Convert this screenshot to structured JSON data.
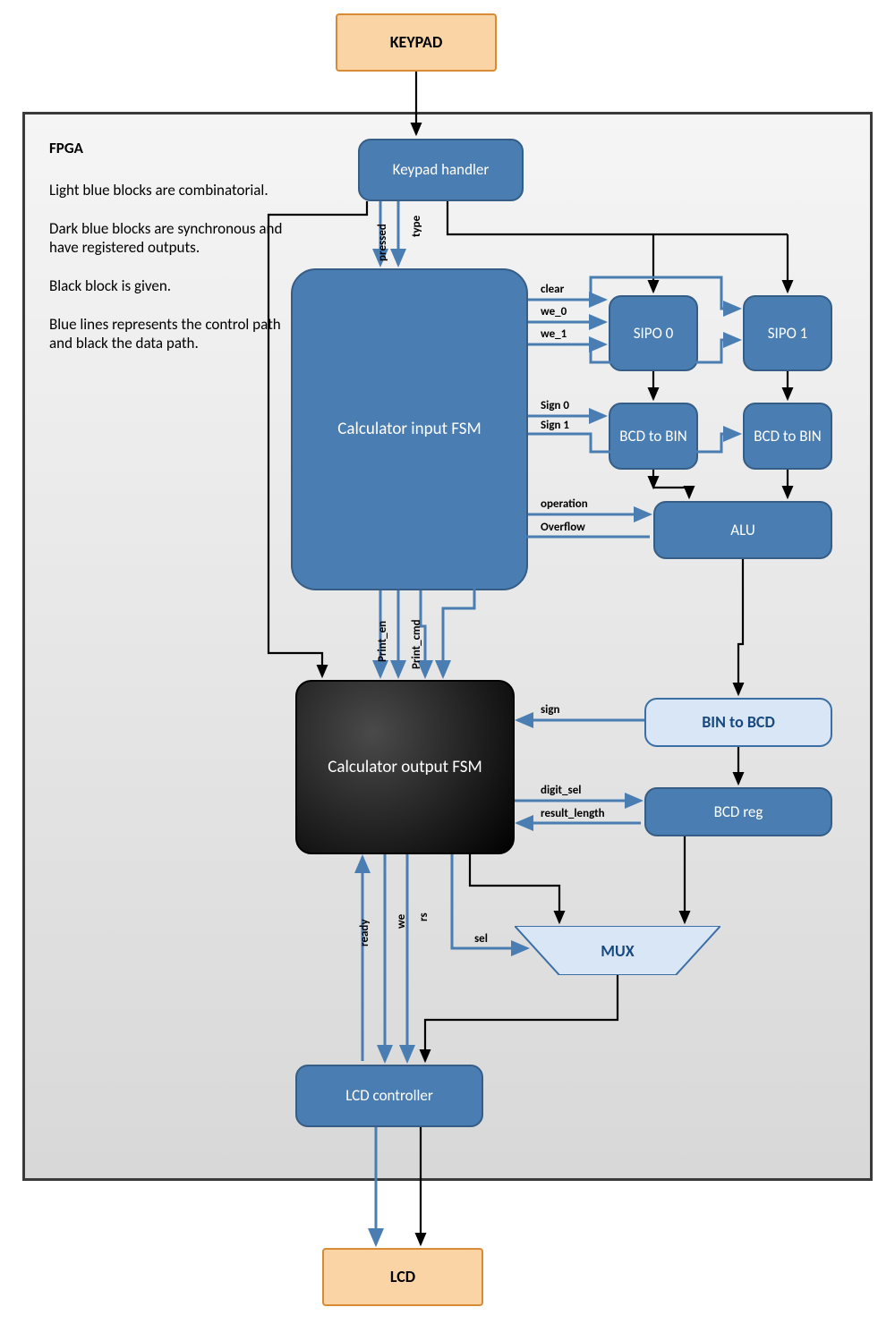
{
  "blocks": {
    "keypad": "KEYPAD",
    "lcd": "LCD",
    "keypad_handler": "Keypad handler",
    "calc_in_fsm": "Calculator input FSM",
    "calc_out_fsm": "Calculator output FSM",
    "lcd_ctrl": "LCD controller",
    "sipo0": "SIPO 0",
    "sipo1": "SIPO 1",
    "bcd2bin0": "BCD to BIN",
    "bcd2bin1": "BCD to BIN",
    "alu": "ALU",
    "bin2bcd": "BIN to BCD",
    "bcd_reg": "BCD reg",
    "mux": "MUX"
  },
  "signals": {
    "pressed": "pressed",
    "type": "type",
    "clear": "clear",
    "we0": "we_0",
    "we1": "we_1",
    "sign0": "Sign 0",
    "sign1": "Sign 1",
    "operation": "operation",
    "overflow": "Overflow",
    "print_en": "Print_en",
    "print_cmd": "Print_cmd",
    "sign": "sign",
    "digit_sel": "digit_sel",
    "result_length": "result_length",
    "ready": "ready",
    "we": "we",
    "rs": "rs",
    "sel": "sel"
  },
  "desc": {
    "title": "FPGA",
    "p1": "Light blue blocks are combinatorial.",
    "p2": "Dark blue blocks are synchronous and have registered outputs.",
    "p3": "Black block is given.",
    "p4": "Blue lines represents the control path and black the data path."
  }
}
